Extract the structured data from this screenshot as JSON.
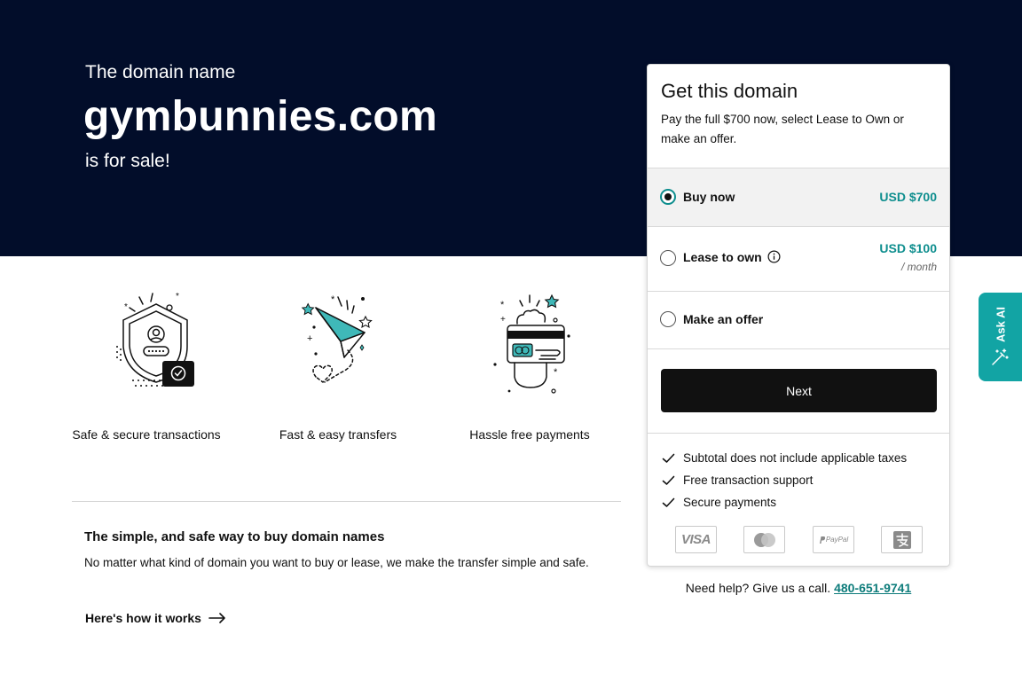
{
  "hero": {
    "eyebrow": "The domain name",
    "domain": "gymbunnies.com",
    "tagline": "is for sale!"
  },
  "features": [
    {
      "icon": "shield-lock-icon",
      "label": "Safe & secure transactions"
    },
    {
      "icon": "paper-plane-icon",
      "label": "Fast & easy transfers"
    },
    {
      "icon": "card-hand-icon",
      "label": "Hassle free payments"
    }
  ],
  "info": {
    "title": "The simple, and safe way to buy domain names",
    "text": "No matter what kind of domain you want to buy or lease, we make the transfer simple and safe.",
    "link": "Here's how it works"
  },
  "card": {
    "title": "Get this domain",
    "desc": "Pay the full $700 now, select Lease to Own or make an offer.",
    "options": {
      "buy": {
        "label": "Buy now",
        "price": "USD $700",
        "selected": true
      },
      "lease": {
        "label": "Lease to own",
        "price": "USD $100",
        "sub": "/ month"
      },
      "offer": {
        "label": "Make an offer"
      }
    },
    "next_label": "Next",
    "checks": [
      "Subtotal does not include applicable taxes",
      "Free transaction support",
      "Secure payments"
    ],
    "payments": {
      "visa": "VISA",
      "mastercard": "mastercard-icon",
      "paypal": "PayPal",
      "alipay": "alipay-icon"
    }
  },
  "help": {
    "text": "Need help? Give us a call.",
    "phone": "480-651-9741"
  },
  "ask_ai": {
    "label": "Ask AI"
  },
  "colors": {
    "hero_bg": "#020d2a",
    "accent": "#0e8e8e",
    "button": "#111111",
    "ask_ai_bg": "#12a4a4"
  }
}
